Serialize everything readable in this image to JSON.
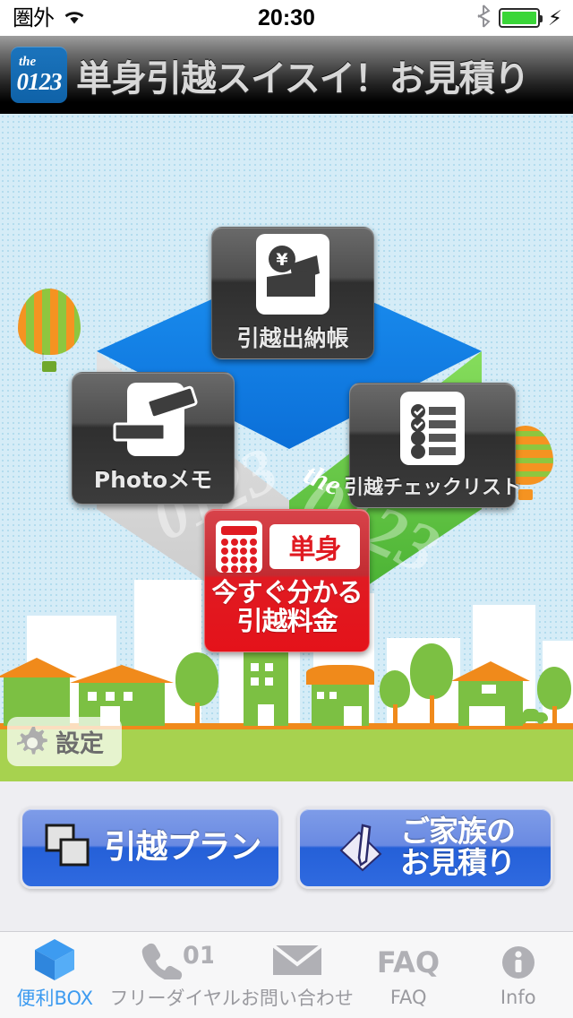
{
  "status_bar": {
    "carrier": "圏外",
    "wifi_icon": "wifi-icon",
    "time": "20:30",
    "bluetooth_icon": "bluetooth-icon",
    "battery_icon": "battery-full-icon",
    "charging_icon": "charging-bolt-icon",
    "battery_color": "#3ad638"
  },
  "header": {
    "logo_the": "the",
    "logo_number": "0123",
    "title": "単身引越スイスイ！お見積り",
    "logo_color": "#1570b8"
  },
  "stage": {
    "box_brand_the": "the",
    "box_brand_number": "0123",
    "face_top_color": "#0b7fe8",
    "face_left_color": "#d4d4d4",
    "face_right_color": "#5fc23a"
  },
  "tiles": [
    {
      "id": "kaikeibo",
      "label": "引越出納帳",
      "icon": "yen-wallet-icon"
    },
    {
      "id": "photomemo",
      "label": "Photoメモ",
      "icon": "photo-note-icon"
    },
    {
      "id": "checklist",
      "label": "引越チェックリスト",
      "icon": "checklist-icon"
    }
  ],
  "promo": {
    "calculator_icon": "calculator-icon",
    "badge": "単身",
    "line1": "今すぐ分かる",
    "line2": "引越料金",
    "color": "#e4121a"
  },
  "settings": {
    "label": "設定",
    "icon": "gear-icon"
  },
  "actions": [
    {
      "id": "plan",
      "label_line1": "引越プラン",
      "label_line2": "",
      "icon": "squares-icon"
    },
    {
      "id": "family-quote",
      "label_line1": "ご家族の",
      "label_line2": "お見積り",
      "icon": "pen-paper-icon"
    }
  ],
  "tabbar": {
    "active_color": "#3d9bf0",
    "inactive_color": "#9a9a9f",
    "items": [
      {
        "id": "benri-box",
        "label": "便利BOX",
        "icon": "cube-icon",
        "active": true
      },
      {
        "id": "freedial",
        "label": "フリーダイヤル",
        "icon": "phone-0123-icon",
        "active": false
      },
      {
        "id": "contact",
        "label": "お問い合わせ",
        "icon": "envelope-icon",
        "active": false
      },
      {
        "id": "faq",
        "label": "FAQ",
        "icon": "faq-icon",
        "active": false
      },
      {
        "id": "info",
        "label": "Info",
        "icon": "info-circle-icon",
        "active": false
      }
    ]
  }
}
